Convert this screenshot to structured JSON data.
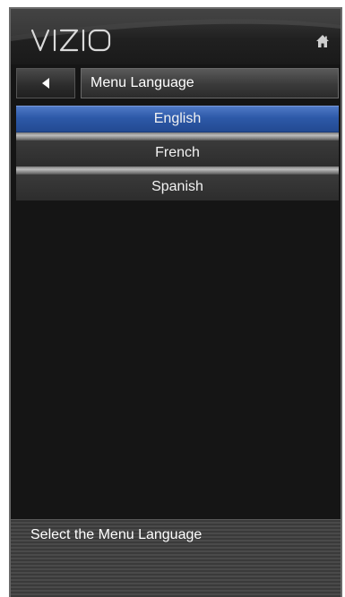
{
  "app": {
    "brand": "VIZIO"
  },
  "header": {
    "home_icon": "home-icon"
  },
  "nav": {
    "back_icon": "back-arrow-icon",
    "title": "Menu Language"
  },
  "menu": {
    "items": [
      {
        "label": "English",
        "selected": true
      },
      {
        "label": "French",
        "selected": false
      },
      {
        "label": "Spanish",
        "selected": false
      }
    ]
  },
  "help": {
    "text": "Select the Menu Language"
  },
  "colors": {
    "panel_background": "#151515",
    "selected_item": "#2d59a8",
    "text": "#ffffff"
  }
}
